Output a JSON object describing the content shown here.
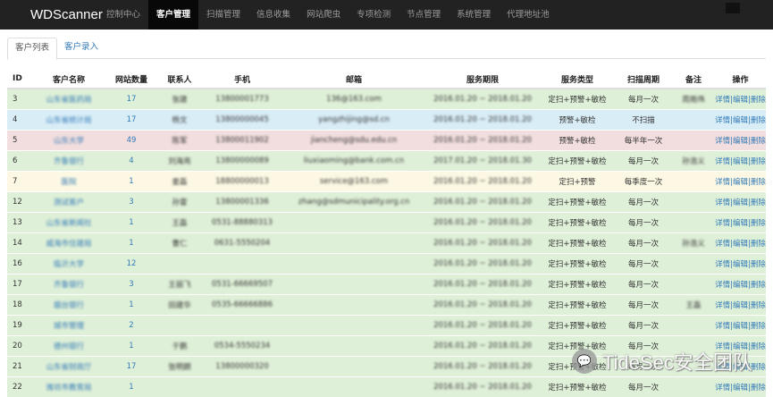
{
  "navbar": {
    "brand": "WDScanner",
    "items": [
      {
        "label": "控制中心"
      },
      {
        "label": "客户管理",
        "active": true
      },
      {
        "label": "扫描管理"
      },
      {
        "label": "信息收集"
      },
      {
        "label": "网站爬虫"
      },
      {
        "label": "专项检测"
      },
      {
        "label": "节点管理"
      },
      {
        "label": "系统管理"
      },
      {
        "label": "代理地址池"
      }
    ]
  },
  "tabs": [
    {
      "label": "客户列表",
      "active": true
    },
    {
      "label": "客户录入"
    }
  ],
  "table": {
    "headers": [
      "ID",
      "客户名称",
      "网站数量",
      "联系人",
      "手机",
      "邮箱",
      "服务期限",
      "服务类型",
      "扫描周期",
      "备注",
      "操作"
    ],
    "ops": {
      "detail": "详情",
      "sep": "|",
      "edit": "编辑",
      "delete": "删除"
    },
    "rows": [
      {
        "id": "3",
        "name": "山东省医药局",
        "sites": "17",
        "contact": "张建",
        "phone": "13800001773",
        "email": "136@163.com",
        "term": "2016.01.20 ~ 2018.01.20",
        "type": "定扫+预警+敏检",
        "cycle": "每月一次",
        "note": "周雨伟",
        "row_class": "success"
      },
      {
        "id": "4",
        "name": "山东省统计局",
        "sites": "17",
        "contact": "杨文",
        "phone": "13800000045",
        "email": "yangzhijing@sd.cn",
        "term": "2016.01.20 ~ 2018.01.20",
        "type": "预警+敏检",
        "cycle": "不扫描",
        "note": "",
        "row_class": "info"
      },
      {
        "id": "5",
        "name": "山东大学",
        "sites": "49",
        "contact": "陈军",
        "phone": "13800011902",
        "email": "jiancheng@sdu.edu.cn",
        "term": "2016.01.20 ~ 2018.01.20",
        "type": "预警+敏检",
        "cycle": "每半年一次",
        "note": "",
        "row_class": "danger"
      },
      {
        "id": "6",
        "name": "齐鲁银行",
        "sites": "4",
        "contact": "刘海亮",
        "phone": "13800000089",
        "email": "liuxiaoming@bank.com.cn",
        "term": "2017.01.20 ~ 2018.01.30",
        "type": "定扫+预警+敏检",
        "cycle": "每月一次",
        "note": "孙浩义",
        "row_class": "success"
      },
      {
        "id": "7",
        "name": "医院",
        "sites": "1",
        "contact": "姜磊",
        "phone": "18800000013",
        "email": "service@163.com",
        "term": "2016.01.20 ~ 2018.01.20",
        "type": "定扫+预警",
        "cycle": "每季度一次",
        "note": "",
        "row_class": "warning"
      },
      {
        "id": "12",
        "name": "测试客户",
        "sites": "3",
        "contact": "孙雷",
        "phone": "13800001336",
        "email": "zhang@sdmunicipality.org.cn",
        "term": "2016.01.20 ~ 2018.01.20",
        "type": "定扫+预警+敏检",
        "cycle": "每月一次",
        "note": "",
        "row_class": "success"
      },
      {
        "id": "13",
        "name": "山东省新闻社",
        "sites": "1",
        "contact": "王磊",
        "phone": "0531-88880313",
        "email": "",
        "term": "2016.01.20 ~ 2018.01.20",
        "type": "定扫+预警+敏检",
        "cycle": "每月一次",
        "note": "",
        "row_class": "success"
      },
      {
        "id": "14",
        "name": "威海市住建局",
        "sites": "1",
        "contact": "曹仁",
        "phone": "0631-5550204",
        "email": "",
        "term": "2016.01.20 ~ 2018.01.20",
        "type": "定扫+预警+敏检",
        "cycle": "每月一次",
        "note": "孙浩义",
        "row_class": "success"
      },
      {
        "id": "16",
        "name": "临沂大学",
        "sites": "12",
        "contact": "",
        "phone": "",
        "email": "",
        "term": "2016.01.20 ~ 2018.01.20",
        "type": "定扫+预警+敏检",
        "cycle": "每月一次",
        "note": "",
        "row_class": "success"
      },
      {
        "id": "17",
        "name": "齐鲁银行",
        "sites": "3",
        "contact": "王丽飞",
        "phone": "0531-66669507",
        "email": "",
        "term": "2016.01.20 ~ 2018.01.20",
        "type": "定扫+预警+敏检",
        "cycle": "每月一次",
        "note": "",
        "row_class": "success"
      },
      {
        "id": "18",
        "name": "烟台银行",
        "sites": "1",
        "contact": "田建华",
        "phone": "0535-66666886",
        "email": "",
        "term": "2016.01.20 ~ 2018.01.20",
        "type": "定扫+预警+敏检",
        "cycle": "每月一次",
        "note": "王磊",
        "row_class": "success"
      },
      {
        "id": "19",
        "name": "城市管理",
        "sites": "2",
        "contact": "",
        "phone": "",
        "email": "",
        "term": "2016.01.20 ~ 2018.01.20",
        "type": "定扫+预警+敏检",
        "cycle": "每月一次",
        "note": "",
        "row_class": "success"
      },
      {
        "id": "20",
        "name": "德州银行",
        "sites": "1",
        "contact": "于鹏",
        "phone": "0534-5550234",
        "email": "",
        "term": "2016.01.20 ~ 2018.01.20",
        "type": "定扫+预警+敏检",
        "cycle": "每月一次",
        "note": "",
        "row_class": "success"
      },
      {
        "id": "21",
        "name": "山东省财政厅",
        "sites": "17",
        "contact": "张明朗",
        "phone": "13800000320",
        "email": "",
        "term": "2016.01.20 ~ 2018.01.20",
        "type": "定扫+预警+敏检",
        "cycle": "每月一次",
        "note": "",
        "row_class": "success"
      },
      {
        "id": "22",
        "name": "潍坊市教育局",
        "sites": "1",
        "contact": "",
        "phone": "",
        "email": "",
        "term": "2016.01.20 ~ 2018.01.20",
        "type": "定扫+预警+敏检",
        "cycle": "每月一次",
        "note": "",
        "row_class": "success"
      }
    ]
  },
  "watermark": {
    "text": "TideSec安全团队",
    "icon": "wechat-icon"
  },
  "colors": {
    "navbar": "#222222",
    "link": "#337ab7",
    "success": "#dff0d8",
    "info": "#d9edf7",
    "danger": "#f2dede",
    "warning": "#fcf8e3"
  }
}
